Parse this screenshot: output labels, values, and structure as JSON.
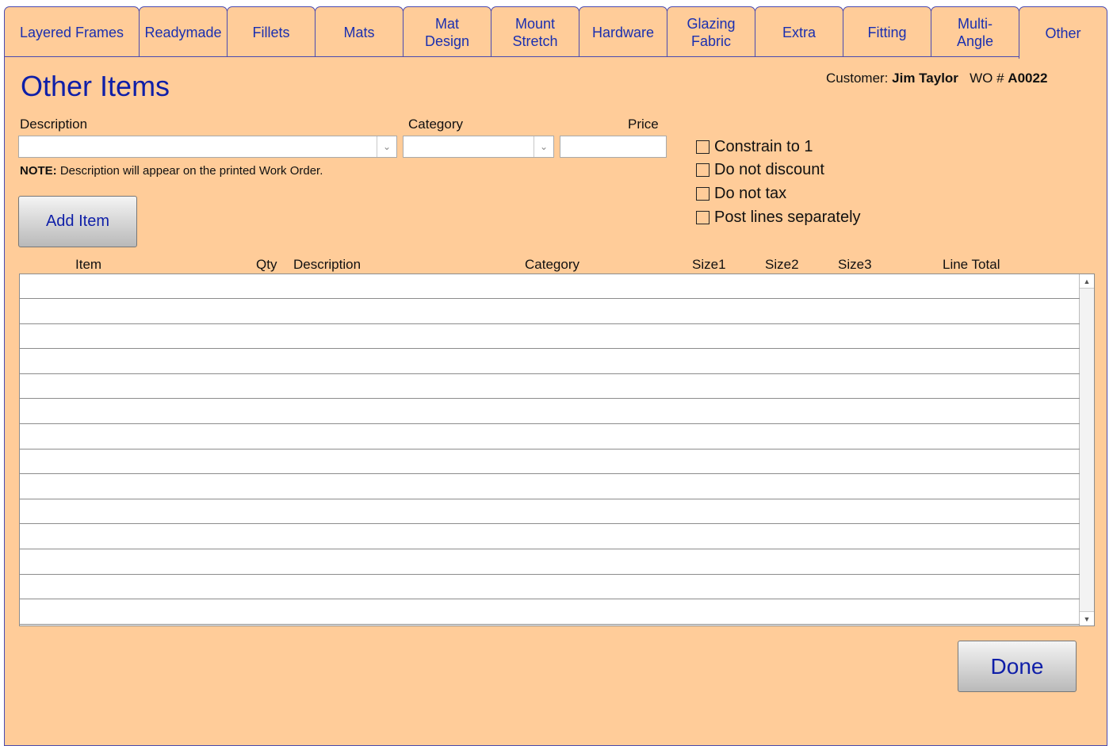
{
  "tabs": [
    {
      "label": "Layered Frames"
    },
    {
      "label": "Readymade"
    },
    {
      "label": "Fillets"
    },
    {
      "label": "Mats"
    },
    {
      "label": "Mat\nDesign"
    },
    {
      "label": "Mount\nStretch"
    },
    {
      "label": "Hardware"
    },
    {
      "label": "Glazing\nFabric"
    },
    {
      "label": "Extra"
    },
    {
      "label": "Fitting"
    },
    {
      "label": "Multi-\nAngle"
    },
    {
      "label": "Other"
    }
  ],
  "active_tab": "Other",
  "page_title": "Other Items",
  "customer": {
    "label": "Customer:",
    "name": "Jim Taylor",
    "wo_label": "WO #",
    "wo_number": "A0022"
  },
  "form": {
    "description_label": "Description",
    "category_label": "Category",
    "price_label": "Price",
    "description_value": "",
    "category_value": "",
    "price_value": "",
    "note_bold": "NOTE:",
    "note_text": "Description will appear on the printed Work Order.",
    "add_item_label": "Add Item"
  },
  "options": [
    {
      "label": "Constrain to 1",
      "checked": false
    },
    {
      "label": "Do not discount",
      "checked": false
    },
    {
      "label": "Do not tax",
      "checked": false
    },
    {
      "label": "Post lines separately",
      "checked": false
    }
  ],
  "table": {
    "columns": [
      "Item",
      "Qty",
      "Description",
      "Category",
      "Size1",
      "Size2",
      "Size3",
      "Line Total"
    ],
    "rows": []
  },
  "done_label": "Done",
  "colors": {
    "panel": "#ffcc99",
    "tab_text": "#1a2fb0",
    "title": "#0f1fa8",
    "border": "#4a4ab0"
  },
  "icons": {
    "dropdown": "chevron-down-icon",
    "scroll_up": "scroll-up-arrow-icon",
    "scroll_down": "scroll-down-arrow-icon"
  }
}
